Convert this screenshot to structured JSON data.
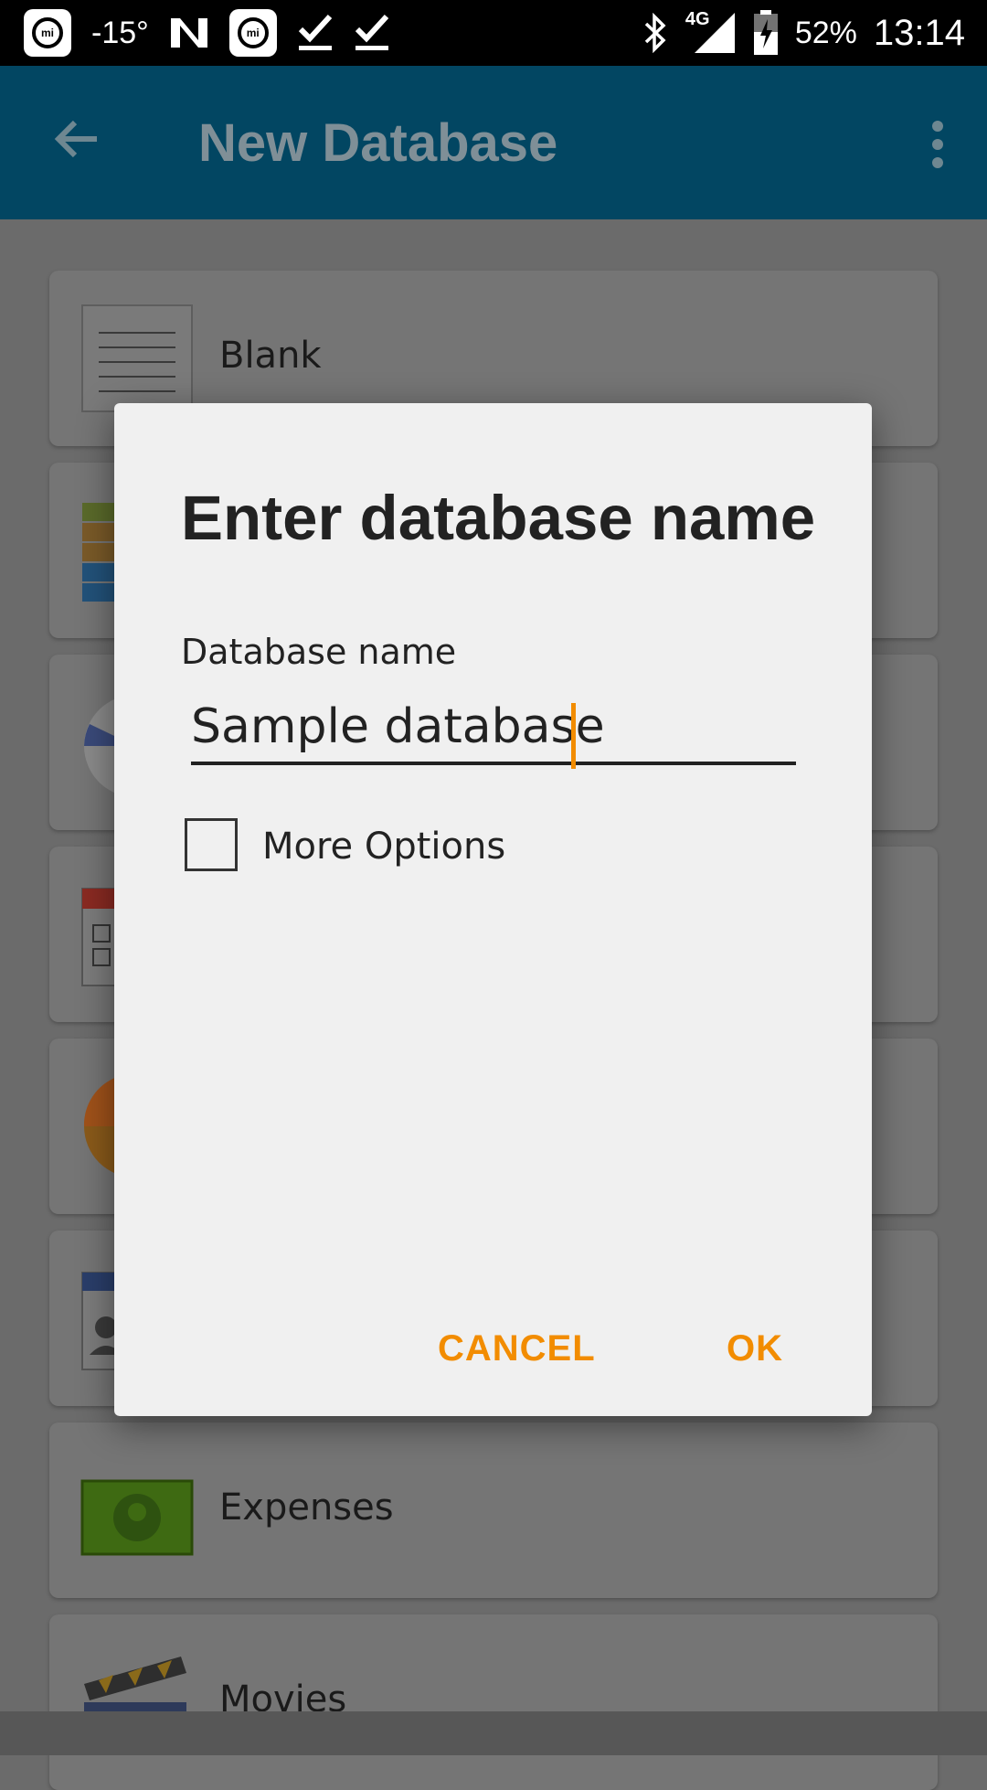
{
  "status_bar": {
    "temperature": "-15°",
    "network": "4G",
    "battery": "52%",
    "time": "13:14",
    "icons": [
      "mi-icon",
      "n-icon",
      "mi-icon",
      "check-icon",
      "check-icon",
      "bluetooth-icon",
      "signal-icon",
      "battery-charging-icon"
    ]
  },
  "app_bar": {
    "title": "New Database",
    "back_icon": "arrow-back-icon",
    "menu_icon": "more-vert-icon"
  },
  "templates": {
    "items": [
      {
        "label": "Blank",
        "icon": "document-lines-icon"
      },
      {
        "label": "",
        "icon": "books-icon"
      },
      {
        "label": "",
        "icon": "pie-icon"
      },
      {
        "label": "",
        "icon": "calendar-checklist-icon"
      },
      {
        "label": "",
        "icon": "pie-orange-icon"
      },
      {
        "label": "",
        "icon": "contact-card-icon"
      },
      {
        "label": "Expenses",
        "icon": "money-icon"
      },
      {
        "label": "Movies",
        "icon": "clapperboard-icon"
      }
    ]
  },
  "dialog": {
    "title": "Enter database name",
    "field_label": "Database name",
    "field_value": "Sample database",
    "checkbox_label": "More Options",
    "checkbox_checked": false,
    "cancel_label": "CANCEL",
    "ok_label": "OK",
    "accent_color": "#f28c00"
  }
}
